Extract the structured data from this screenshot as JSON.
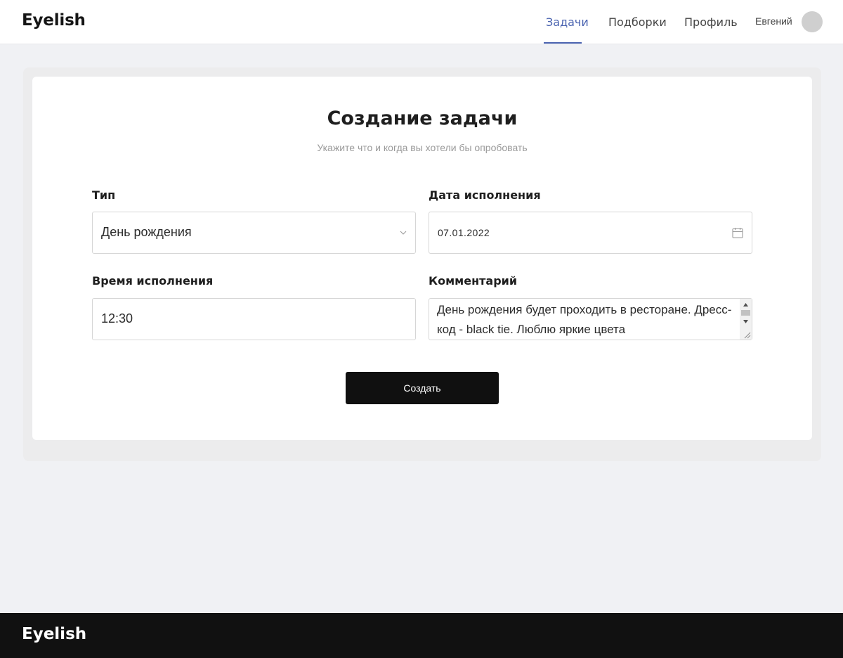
{
  "header": {
    "logo": "Eyelish",
    "nav": [
      {
        "label": "Задачи",
        "active": true
      },
      {
        "label": "Подборки",
        "active": false
      },
      {
        "label": "Профиль",
        "active": false
      }
    ],
    "user_name": "Евгений",
    "accent_color": "#4a63b0"
  },
  "form": {
    "title": "Создание задачи",
    "subtitle": "Укажите что и когда вы хотели бы опробовать",
    "type": {
      "label": "Тип",
      "value": "День рождения",
      "icon": "chevron-down-icon"
    },
    "date": {
      "label": "Дата исполнения",
      "value": "07.01.2022",
      "icon": "calendar-icon"
    },
    "time": {
      "label": "Время исполнения",
      "value": "12:30"
    },
    "comment": {
      "label": "Комментарий",
      "value": "День рождения будет проходить в ресторане. Дресс-код - black tie. Люблю яркие цвета"
    },
    "submit_label": "Создать"
  },
  "footer": {
    "logo": "Eyelish"
  }
}
